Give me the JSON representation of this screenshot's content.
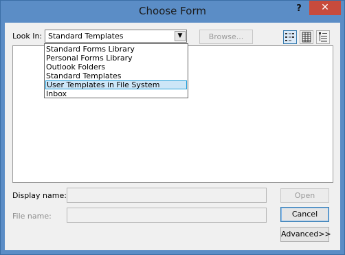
{
  "window": {
    "title": "Choose Form",
    "help_label": "?",
    "close_label": "✕"
  },
  "look_in": {
    "label": "Look In:",
    "selected": "Standard Templates",
    "arrow": "▼",
    "options": [
      "Standard Forms Library",
      "Personal Forms Library",
      "Outlook Folders",
      "Standard Templates",
      "User Templates in File System",
      "Inbox"
    ],
    "highlighted_index": 4
  },
  "toolbar": {
    "browse_label": "Browse...",
    "views": [
      "list-view-icon",
      "details-view-icon",
      "properties-view-icon"
    ]
  },
  "fields": {
    "display_name_label": "Display name:",
    "display_name_value": "",
    "file_name_label": "File name:",
    "file_name_value": ""
  },
  "buttons": {
    "open_label": "Open",
    "cancel_label": "Cancel",
    "advanced_label": "Advanced>>"
  },
  "colors": {
    "frame": "#5b8dc6",
    "close": "#c74b3c",
    "selection": "#cde6f7",
    "selection_border": "#26a0da"
  }
}
